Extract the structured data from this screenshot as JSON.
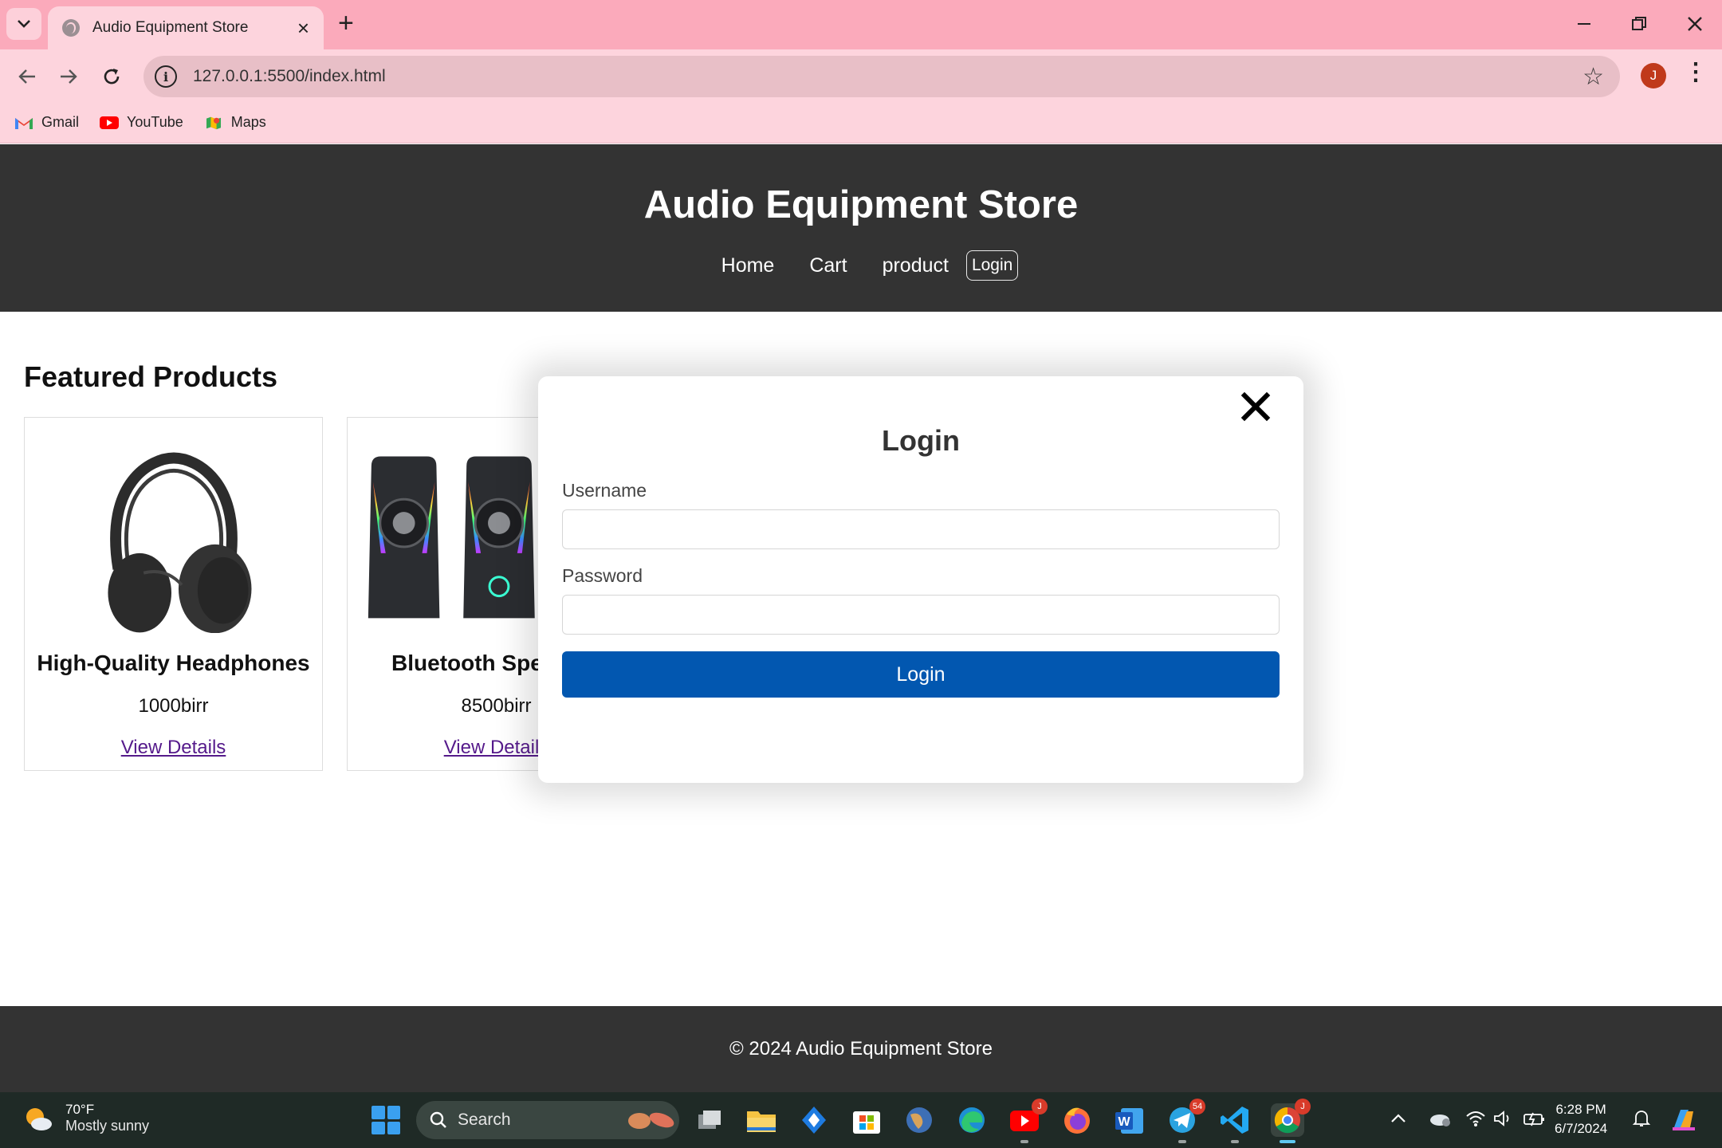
{
  "browser": {
    "tab_title": "Audio Equipment Store",
    "url": "127.0.0.1:5500/index.html",
    "profile_initial": "J",
    "bookmarks": [
      {
        "label": "Gmail",
        "icon": "gmail-icon"
      },
      {
        "label": "YouTube",
        "icon": "youtube-icon"
      },
      {
        "label": "Maps",
        "icon": "maps-icon"
      }
    ]
  },
  "site": {
    "title": "Audio Equipment Store",
    "nav": {
      "home": "Home",
      "cart": "Cart",
      "product": "product",
      "login": "Login"
    },
    "featured_title": "Featured Products",
    "products": [
      {
        "name": "High-Quality Headphones",
        "price": "1000birr",
        "link": "View Details",
        "image": "headphones-image"
      },
      {
        "name": "Bluetooth Speakers",
        "price": "8500birr",
        "link": "View Details",
        "image": "speakers-image"
      }
    ],
    "footer": "© 2024 Audio Equipment Store"
  },
  "modal": {
    "title": "Login",
    "username_label": "Username",
    "username_value": "",
    "password_label": "Password",
    "password_value": "",
    "submit_label": "Login",
    "close_icon": "close-icon"
  },
  "taskbar": {
    "weather_temp": "70°F",
    "weather_desc": "Mostly sunny",
    "search_placeholder": "Search",
    "time": "6:28 PM",
    "date": "6/7/2024",
    "youtube_badge": "J",
    "telegram_badge": "54",
    "chrome_badge": "J"
  },
  "colors": {
    "header_bg": "#333333",
    "login_button": "#0257b0",
    "chrome_tabbar": "#fbaabb",
    "link_visited": "#551a8b"
  }
}
